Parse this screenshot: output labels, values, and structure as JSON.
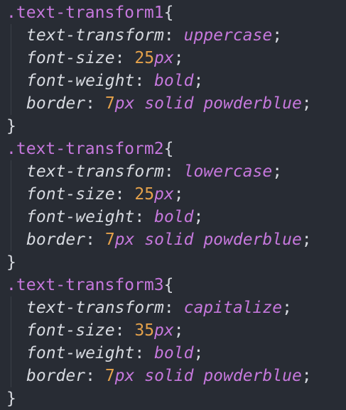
{
  "editor": {
    "language": "CSS",
    "rules": [
      {
        "selector": ".text-transform1",
        "declarations": [
          {
            "property": "text-transform",
            "value": "uppercase"
          },
          {
            "property": "font-size",
            "number": "25",
            "unit": "px"
          },
          {
            "property": "font-weight",
            "value": "bold"
          },
          {
            "property": "border",
            "number": "7",
            "unit": "px",
            "rest": "solid powderblue"
          }
        ]
      },
      {
        "selector": ".text-transform2",
        "declarations": [
          {
            "property": "text-transform",
            "value": "lowercase"
          },
          {
            "property": "font-size",
            "number": "25",
            "unit": "px"
          },
          {
            "property": "font-weight",
            "value": "bold"
          },
          {
            "property": "border",
            "number": "7",
            "unit": "px",
            "rest": "solid powderblue"
          }
        ]
      },
      {
        "selector": ".text-transform3",
        "declarations": [
          {
            "property": "text-transform",
            "value": "capitalize"
          },
          {
            "property": "font-size",
            "number": "35",
            "unit": "px"
          },
          {
            "property": "font-weight",
            "value": "bold"
          },
          {
            "property": "border",
            "number": "7",
            "unit": "px",
            "rest": "solid powderblue"
          }
        ]
      }
    ],
    "open_brace": "{",
    "close_brace": "}",
    "colon": ":",
    "semicolon": ";"
  },
  "theme": {
    "background": "#282c34",
    "selector_color": "#c678dd",
    "property_color": "#d7dae0",
    "value_color": "#c678dd",
    "number_color": "#e5a24b"
  }
}
